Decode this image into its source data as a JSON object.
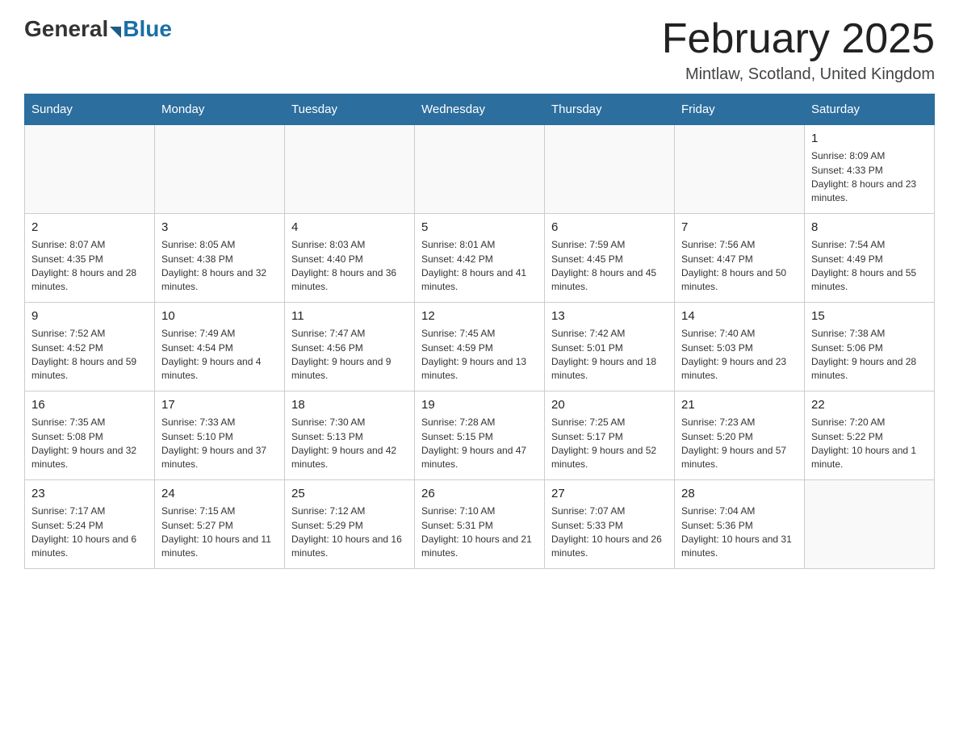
{
  "header": {
    "logo_general": "General",
    "logo_blue": "Blue",
    "month_title": "February 2025",
    "location": "Mintlaw, Scotland, United Kingdom"
  },
  "weekdays": [
    "Sunday",
    "Monday",
    "Tuesday",
    "Wednesday",
    "Thursday",
    "Friday",
    "Saturday"
  ],
  "weeks": [
    [
      {
        "day": "",
        "info": ""
      },
      {
        "day": "",
        "info": ""
      },
      {
        "day": "",
        "info": ""
      },
      {
        "day": "",
        "info": ""
      },
      {
        "day": "",
        "info": ""
      },
      {
        "day": "",
        "info": ""
      },
      {
        "day": "1",
        "info": "Sunrise: 8:09 AM\nSunset: 4:33 PM\nDaylight: 8 hours and 23 minutes."
      }
    ],
    [
      {
        "day": "2",
        "info": "Sunrise: 8:07 AM\nSunset: 4:35 PM\nDaylight: 8 hours and 28 minutes."
      },
      {
        "day": "3",
        "info": "Sunrise: 8:05 AM\nSunset: 4:38 PM\nDaylight: 8 hours and 32 minutes."
      },
      {
        "day": "4",
        "info": "Sunrise: 8:03 AM\nSunset: 4:40 PM\nDaylight: 8 hours and 36 minutes."
      },
      {
        "day": "5",
        "info": "Sunrise: 8:01 AM\nSunset: 4:42 PM\nDaylight: 8 hours and 41 minutes."
      },
      {
        "day": "6",
        "info": "Sunrise: 7:59 AM\nSunset: 4:45 PM\nDaylight: 8 hours and 45 minutes."
      },
      {
        "day": "7",
        "info": "Sunrise: 7:56 AM\nSunset: 4:47 PM\nDaylight: 8 hours and 50 minutes."
      },
      {
        "day": "8",
        "info": "Sunrise: 7:54 AM\nSunset: 4:49 PM\nDaylight: 8 hours and 55 minutes."
      }
    ],
    [
      {
        "day": "9",
        "info": "Sunrise: 7:52 AM\nSunset: 4:52 PM\nDaylight: 8 hours and 59 minutes."
      },
      {
        "day": "10",
        "info": "Sunrise: 7:49 AM\nSunset: 4:54 PM\nDaylight: 9 hours and 4 minutes."
      },
      {
        "day": "11",
        "info": "Sunrise: 7:47 AM\nSunset: 4:56 PM\nDaylight: 9 hours and 9 minutes."
      },
      {
        "day": "12",
        "info": "Sunrise: 7:45 AM\nSunset: 4:59 PM\nDaylight: 9 hours and 13 minutes."
      },
      {
        "day": "13",
        "info": "Sunrise: 7:42 AM\nSunset: 5:01 PM\nDaylight: 9 hours and 18 minutes."
      },
      {
        "day": "14",
        "info": "Sunrise: 7:40 AM\nSunset: 5:03 PM\nDaylight: 9 hours and 23 minutes."
      },
      {
        "day": "15",
        "info": "Sunrise: 7:38 AM\nSunset: 5:06 PM\nDaylight: 9 hours and 28 minutes."
      }
    ],
    [
      {
        "day": "16",
        "info": "Sunrise: 7:35 AM\nSunset: 5:08 PM\nDaylight: 9 hours and 32 minutes."
      },
      {
        "day": "17",
        "info": "Sunrise: 7:33 AM\nSunset: 5:10 PM\nDaylight: 9 hours and 37 minutes."
      },
      {
        "day": "18",
        "info": "Sunrise: 7:30 AM\nSunset: 5:13 PM\nDaylight: 9 hours and 42 minutes."
      },
      {
        "day": "19",
        "info": "Sunrise: 7:28 AM\nSunset: 5:15 PM\nDaylight: 9 hours and 47 minutes."
      },
      {
        "day": "20",
        "info": "Sunrise: 7:25 AM\nSunset: 5:17 PM\nDaylight: 9 hours and 52 minutes."
      },
      {
        "day": "21",
        "info": "Sunrise: 7:23 AM\nSunset: 5:20 PM\nDaylight: 9 hours and 57 minutes."
      },
      {
        "day": "22",
        "info": "Sunrise: 7:20 AM\nSunset: 5:22 PM\nDaylight: 10 hours and 1 minute."
      }
    ],
    [
      {
        "day": "23",
        "info": "Sunrise: 7:17 AM\nSunset: 5:24 PM\nDaylight: 10 hours and 6 minutes."
      },
      {
        "day": "24",
        "info": "Sunrise: 7:15 AM\nSunset: 5:27 PM\nDaylight: 10 hours and 11 minutes."
      },
      {
        "day": "25",
        "info": "Sunrise: 7:12 AM\nSunset: 5:29 PM\nDaylight: 10 hours and 16 minutes."
      },
      {
        "day": "26",
        "info": "Sunrise: 7:10 AM\nSunset: 5:31 PM\nDaylight: 10 hours and 21 minutes."
      },
      {
        "day": "27",
        "info": "Sunrise: 7:07 AM\nSunset: 5:33 PM\nDaylight: 10 hours and 26 minutes."
      },
      {
        "day": "28",
        "info": "Sunrise: 7:04 AM\nSunset: 5:36 PM\nDaylight: 10 hours and 31 minutes."
      },
      {
        "day": "",
        "info": ""
      }
    ]
  ]
}
